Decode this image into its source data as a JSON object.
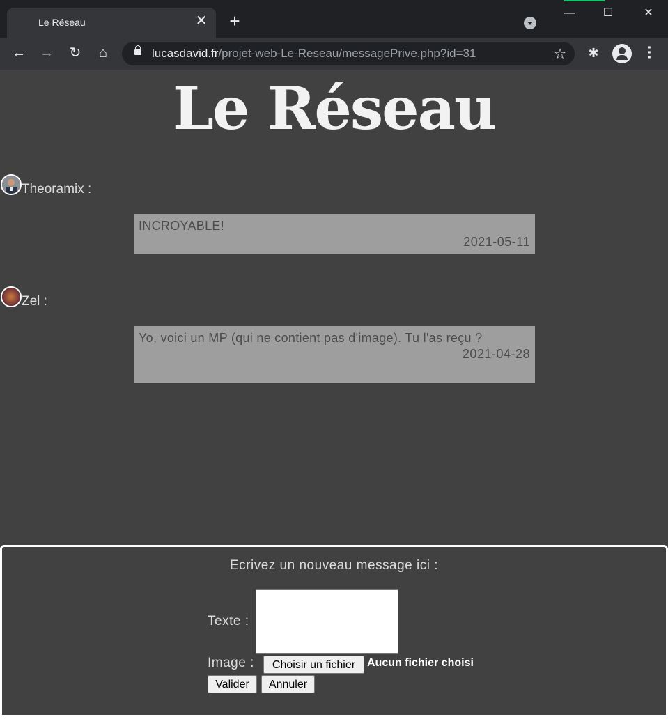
{
  "browser": {
    "tab_title": "Le Réseau",
    "tab_close": "✕",
    "new_tab": "+",
    "url_host": "lucasdavid.fr",
    "url_path": "/projet-web-Le-Reseau/messagePrive.php?id=31",
    "icons": [
      "back-icon",
      "forward-icon",
      "reload-icon",
      "home-icon",
      "lock-icon",
      "star-icon",
      "extensions-icon",
      "profile-icon",
      "menu-icon",
      "tab-search-icon"
    ]
  },
  "page": {
    "site_title": "Le Réseau"
  },
  "messages": [
    {
      "author": "Theoramix :",
      "text": "INCROYABLE!",
      "date": "2021-05-11"
    },
    {
      "author": "Zel :",
      "text": "Yo, voici un MP (qui ne contient pas d'image). Tu l'as reçu ?",
      "date": "2021-04-28"
    }
  ],
  "compose": {
    "title": "Ecrivez un nouveau message ici :",
    "text_label": "Texte :",
    "image_label": "Image :",
    "file_button": "Choisir un fichier",
    "file_status": "Aucun fichier choisi",
    "submit": "Valider",
    "cancel": "Annuler"
  },
  "colors": {
    "background": "#414141",
    "message_bg": "#9e9e9e",
    "chrome_dark": "#202124",
    "chrome_toolbar": "#35363a"
  }
}
